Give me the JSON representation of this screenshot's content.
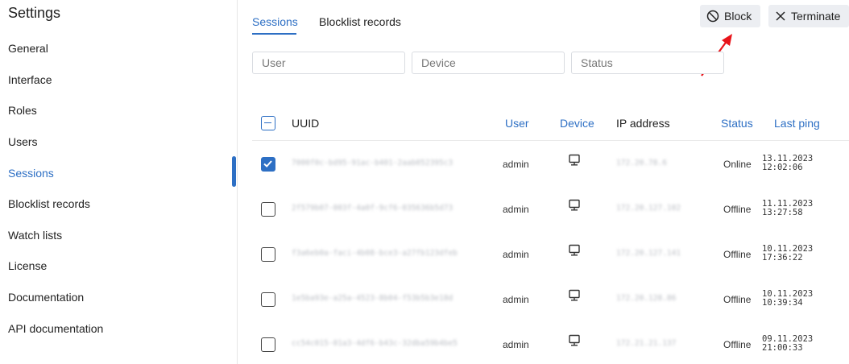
{
  "sidebar": {
    "title": "Settings",
    "items": [
      {
        "label": "General"
      },
      {
        "label": "Interface"
      },
      {
        "label": "Roles"
      },
      {
        "label": "Users"
      },
      {
        "label": "Sessions",
        "active": true
      },
      {
        "label": "Blocklist records"
      },
      {
        "label": "Watch lists"
      },
      {
        "label": "License"
      },
      {
        "label": "Documentation"
      },
      {
        "label": "API documentation"
      }
    ]
  },
  "tabs": [
    {
      "label": "Sessions",
      "active": true
    },
    {
      "label": "Blocklist records"
    }
  ],
  "toolbar": {
    "block_label": "Block",
    "block_icon": "block-icon",
    "terminate_label": "Terminate",
    "terminate_icon": "close-icon"
  },
  "filters": {
    "user_placeholder": "User",
    "device_placeholder": "Device",
    "status_placeholder": "Status"
  },
  "table": {
    "columns": {
      "uuid": "UUID",
      "user": "User",
      "device": "Device",
      "ip": "IP address",
      "status": "Status",
      "last_ping": "Last ping"
    },
    "rows": [
      {
        "checked": true,
        "uuid": "7000f0c-bd95-91ac-b401-2aab052395c3",
        "user": "admin",
        "device_icon": "monitor-icon",
        "ip": "172.20.78.6",
        "status": "Online",
        "ping_date": "13.11.2023",
        "ping_time": "12:02:06"
      },
      {
        "checked": false,
        "uuid": "2f579b07-003f-4a0f-9cf6-035636b5d73",
        "user": "admin",
        "device_icon": "monitor-icon",
        "ip": "172.20.127.102",
        "status": "Offline",
        "ping_date": "11.11.2023",
        "ping_time": "13:27:58"
      },
      {
        "checked": false,
        "uuid": "f3a6eb0a-faci-4b08-bce3-a27fb123dfeb",
        "user": "admin",
        "device_icon": "monitor-icon",
        "ip": "172.20.127.141",
        "status": "Offline",
        "ping_date": "10.11.2023",
        "ping_time": "17:36:22"
      },
      {
        "checked": false,
        "uuid": "1e5ba93e-a25a-4523-8b04-f53b5b3e18d",
        "user": "admin",
        "device_icon": "monitor-icon",
        "ip": "172.20.128.86",
        "status": "Offline",
        "ping_date": "10.11.2023",
        "ping_time": "10:39:34"
      },
      {
        "checked": false,
        "uuid": "cc54c015-01a3-4df6-b43c-32dba59b4be5",
        "user": "admin",
        "device_icon": "monitor-icon",
        "ip": "172.21.21.137",
        "status": "Offline",
        "ping_date": "09.11.2023",
        "ping_time": "21:00:33"
      }
    ]
  },
  "accent_color": "#2d6fc4",
  "annotation_color": "#e8141a"
}
